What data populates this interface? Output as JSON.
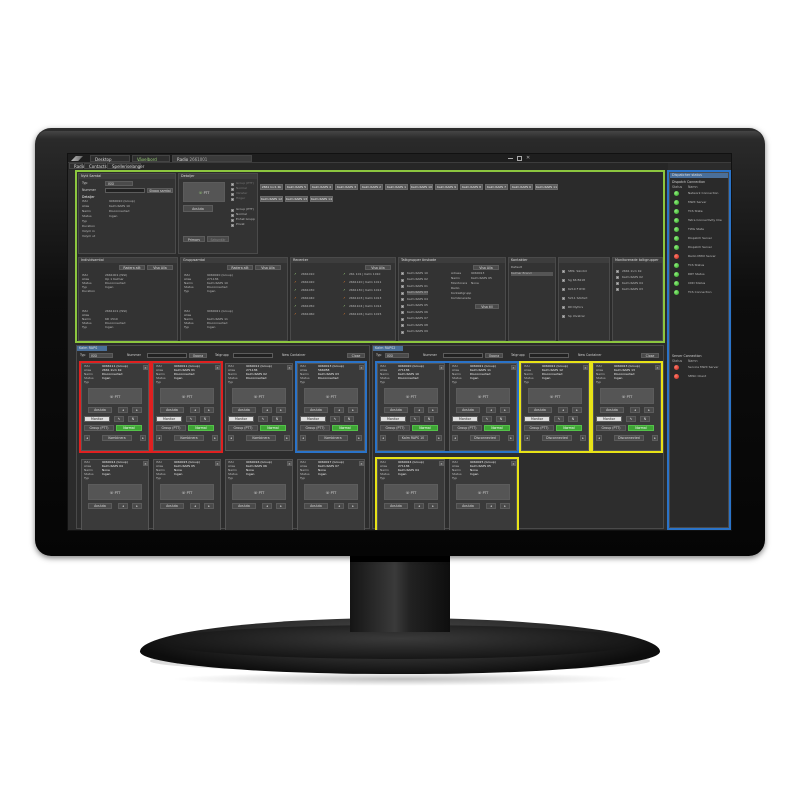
{
  "app": {
    "tabs": [
      {
        "label": "Desktop"
      },
      {
        "label": "Växelbord"
      },
      {
        "label": "Radio",
        "sub": "2661001"
      }
    ],
    "subtabs": [
      "Radio",
      "Contacts",
      "Spelleriselanger"
    ]
  },
  "top_left": {
    "title": "Nytt Samtal",
    "typ_label": "Typ",
    "typ_value": "ISSI",
    "nummer_label": "Nummer",
    "button": "Skapa samtal",
    "detail_title": "Detaljer",
    "rows": [
      {
        "k": "ISSI",
        "v": "9060010 (Group)"
      },
      {
        "k": "Alias",
        "v": "Kalm RAPS 10"
      },
      {
        "k": "Namn",
        "v": "Disconnected"
      },
      {
        "k": "Status",
        "v": "Ingen"
      },
      {
        "k": "Typ",
        "v": ""
      },
      {
        "k": "Duration",
        "v": ""
      },
      {
        "k": "Volym in",
        "v": ""
      },
      {
        "k": "Volym ut",
        "v": ""
      }
    ]
  },
  "detail_panel": {
    "title": "Detaljer",
    "ptt": "PTT",
    "answer": "Avsluta",
    "primary": "Primary",
    "secondary": "Sekundär",
    "options": [
      "Group (PTT)",
      "Normal",
      "Vänster",
      "Höger",
      "Group (PTT)",
      "Normal",
      "Enhet Grupp",
      "Privat"
    ]
  },
  "tgbuttons": [
    "2661 Inc1 Kk",
    "Kalm RAPS 5",
    "Kalm RAPS 4",
    "Kalm RAPS 3",
    "Kalm RAPS 2",
    "Kalm RAPS 1",
    "Kalm RAPS 10",
    "Kalm RAPS 9",
    "Kalm RAPS 8",
    "Kalm RAPS 7",
    "Kalm RAPS 6",
    "Kalm RAPS 11",
    "Kalm RAPS 12",
    "Kalm RAPS 13",
    "Kalm RAPS 14",
    "Kalm RAPS 15",
    "Kalm RAPS 16",
    "Kalm RAPS 17"
  ],
  "mid_panels": {
    "individual": {
      "title": "Individsamtal",
      "btn1": "Radera allt",
      "btn2": "Visa Alla",
      "rows1": [
        [
          "ISSI",
          "2661001 (ISSI)"
        ],
        [
          "Alias",
          "Op 1 Kalmar"
        ],
        [
          "Status",
          "Disconnected"
        ],
        [
          "Typ",
          "Ingen"
        ],
        [
          "Duration",
          ""
        ]
      ],
      "rows2": [
        [
          "ISSI",
          "2661101 (ISSI)"
        ],
        [
          "Alias",
          ""
        ],
        [
          "Namn",
          "6D 1510"
        ],
        [
          "Status",
          "Disconnected"
        ],
        [
          "Typ",
          "Ingen"
        ]
      ]
    },
    "group": {
      "title": "Gruppsamtal",
      "btn1": "Radera allt",
      "btn2": "Visa Alla",
      "rows1": [
        [
          "ISSI",
          "9060020 (Group)"
        ],
        [
          "Alias",
          "271136"
        ],
        [
          "Namn",
          "Kalm RAPS 10"
        ],
        [
          "Status",
          "Disconnected"
        ],
        [
          "Typ",
          "Ingen"
        ]
      ],
      "rows2": [
        [
          "ISSI",
          "9060021 (Group)"
        ],
        [
          "Alias",
          ""
        ],
        [
          "Namn",
          "Kalm RAPS 11"
        ],
        [
          "Status",
          "Disconnected"
        ],
        [
          "Typ",
          "Ingen"
        ]
      ]
    },
    "recent": {
      "title": "Recenter",
      "btn": "Visa Alla",
      "calls": [
        "2661010",
        "2661020",
        "2661030",
        "2661040",
        "2661050",
        "2661060"
      ],
      "calls2": [
        "261 101 | Kalm 1010",
        "2661120 | Kalm 1011",
        "2661130 | Kalm 1012",
        "2661103 | Kalm 1013",
        "2661104 | Kalm 1014",
        "2661106 | Kalm 1015"
      ]
    },
    "talkgroups": {
      "title": "Talkgrupper önskade",
      "btn": "Visa Alla",
      "list": [
        "Kalm RAPS 10",
        "Kalm RAPS 02",
        "Kalm RAPS 01",
        "Kalm RAPS 03",
        "Kalm RAPS 04",
        "Kalm RAPS 05",
        "Kalm RAPS 06",
        "Kalm RAPS 07",
        "Kalm RAPS 08",
        "Kalm RAPS 09"
      ],
      "detail": [
        [
          "Adress",
          "9060013"
        ],
        [
          "Namn",
          "Kalm RAPS 05"
        ],
        [
          "Monitorera",
          "None"
        ],
        [
          "Radio",
          ""
        ],
        [
          "Kontaktgrupp",
          ""
        ],
        [
          "Kombinerade",
          ""
        ]
      ],
      "btn2": "Visa till"
    },
    "contacts": {
      "title": "Kontakter",
      "list": [
        "Default",
        "Kalmar Brand"
      ]
    },
    "sms": {
      "title": "",
      "list": [
        "SMS: Sändid",
        "Sg 66 Bil18",
        "6210 F RYD",
        "5211 Sökfart",
        "RD Nyfors",
        "Sp Ulvatrar"
      ]
    },
    "monitor": {
      "title": "Monitorerade talkgrupper",
      "list": [
        "2661 Inc1 Kk",
        "Kalm RAPS 02",
        "Kalm RAPS 04",
        "Kalm RAPS 03"
      ]
    }
  },
  "right_panel": {
    "title": "Dispatcher status",
    "section": "Dispatch Connection",
    "col1": "Status",
    "col2": "Namn",
    "items": [
      {
        "name": "Network Connection",
        "ok": true
      },
      {
        "name": "MWX Server",
        "ok": true
      },
      {
        "name": "TCS State",
        "ok": true
      },
      {
        "name": "Tetra Connectivity Clie",
        "ok": true
      },
      {
        "name": "TWG State",
        "ok": true
      },
      {
        "name": "Dispatch Server",
        "ok": true
      },
      {
        "name": "Dispatch Server",
        "ok": true
      },
      {
        "name": "Radio MWX Server",
        "ok": false
      },
      {
        "name": "TCS Status",
        "ok": true
      },
      {
        "name": "DRT Status",
        "ok": true
      },
      {
        "name": "CDD Status",
        "ok": true
      },
      {
        "name": "TCS Connection",
        "ok": true
      }
    ],
    "section2": "Server Connection",
    "items2": [
      {
        "name": "Service MWX Server",
        "ok": false
      },
      {
        "name": "SMSC Client",
        "ok": false
      }
    ]
  },
  "containers": [
    {
      "title": "Kalm RAPS",
      "typ_label": "Typ",
      "typ_value": "ISSI",
      "nummer": "Nummer",
      "open": "Öppna",
      "tab": "Talgrupp",
      "new": "New Container",
      "close": "Close"
    },
    {
      "title": "Kalm RAPS2",
      "typ_label": "Typ",
      "typ_value": "ISSI",
      "nummer": "Nummer",
      "open": "Öppna",
      "tab": "Talgrupp",
      "new": "New Container",
      "close": "Close"
    }
  ],
  "cards_left": [
    {
      "issi": "9066111 (Group)",
      "alias": "2661 Inc1 Kk",
      "name": "Disconnected",
      "status": "Ingen"
    },
    {
      "issi": "9060011 (Group)",
      "alias": "Kalm RAPS 01",
      "name": "Disconnected",
      "status": "Ingen"
    },
    {
      "issi": "9060012 (Group)",
      "alias": "271136",
      "name": "Kalm RAPS 02",
      "status": "Disconnected"
    },
    {
      "issi": "9060013 (Group)",
      "alias": "566058",
      "name": "Kalm RAPS 03",
      "status": "Disconnected"
    },
    {
      "issi": "9060014 (Group)",
      "alias": "Kalm RAPS 04",
      "name": "None",
      "status": "Ingen"
    },
    {
      "issi": "9060015 (Group)",
      "alias": "Kalm RAPS 05",
      "name": "None",
      "status": "Ingen"
    },
    {
      "issi": "9060016 (Group)",
      "alias": "Kalm RAPS 06",
      "name": "None",
      "status": "Ingen"
    },
    {
      "issi": "9060017 (Group)",
      "alias": "Kalm RAPS 07",
      "name": "None",
      "status": "Ingen"
    }
  ],
  "cards_right": [
    {
      "issi": "9060020 (Group)",
      "alias": "271136",
      "name": "Kalm RAPS 10",
      "status": "Disconnected"
    },
    {
      "issi": "9060021 (Group)",
      "alias": "Kalm RAPS 11",
      "name": "Disconnected",
      "status": "Ingen"
    },
    {
      "issi": "9060022 (Group)",
      "alias": "Kalm RAPS 12",
      "name": "Disconnected",
      "status": "Ingen"
    },
    {
      "issi": "9060023 (Group)",
      "alias": "Kalm RAPS 13",
      "name": "Disconnected",
      "status": "Ingen"
    },
    {
      "issi": "9060024 (Group)",
      "alias": "271136",
      "name": "Kalm RAPS 04",
      "status": "Ingen"
    },
    {
      "issi": "9060025 (Group)",
      "alias": "Kalm RAPS 05",
      "name": "None",
      "status": "Ingen"
    }
  ],
  "card_labels": {
    "issi": "ISSI",
    "alias": "Alias",
    "name": "Namn",
    "status": "Status",
    "typ": "Typ",
    "ptt": "PTT",
    "avsluta": "Avsluta",
    "monitor": "Monitor",
    "group": "Group (PTT)",
    "normal": "Normal",
    "kombinera": "Kombinera",
    "bevakgrupp": "Bevakgrupp",
    "ovrigt": "Övrigt"
  },
  "colors": {
    "accent_green": "#3fa535",
    "highlight_red": "#e02020",
    "highlight_blue": "#2a73c8",
    "highlight_yellow": "#e8e317",
    "highlight_lime": "#8cc63f",
    "bg": "#2b2b2b"
  }
}
